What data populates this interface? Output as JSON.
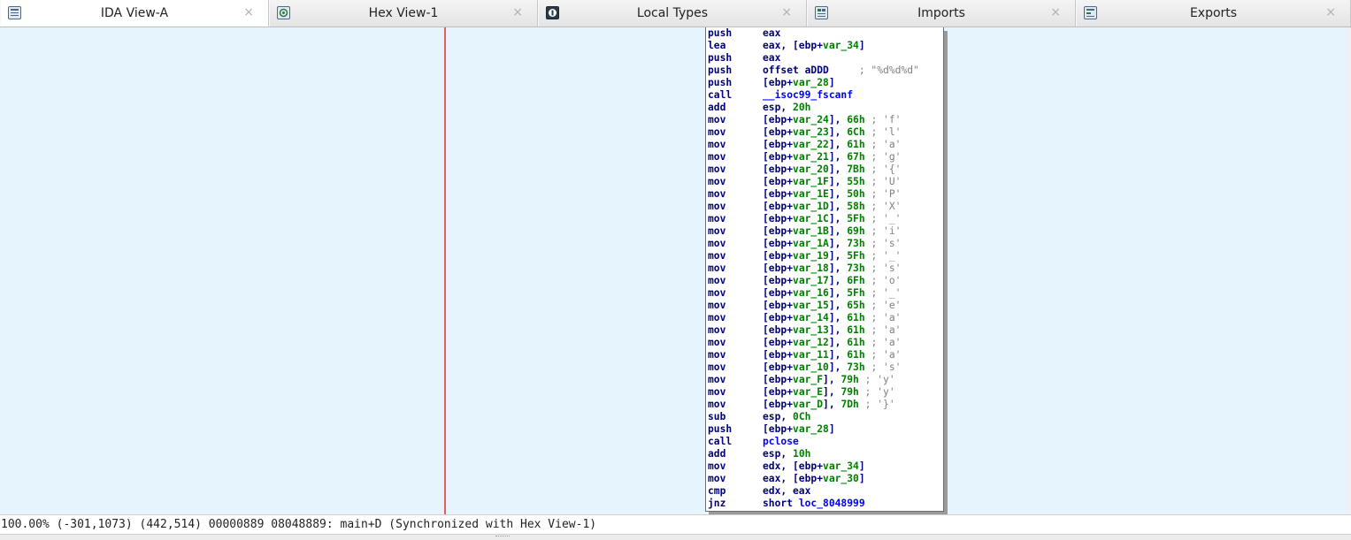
{
  "tabs": [
    {
      "label": "IDA View-A",
      "icon": "ida-view-icon",
      "close": "×",
      "active": true
    },
    {
      "label": "Hex View-1",
      "icon": "hex-view-icon",
      "close": "×",
      "active": false
    },
    {
      "label": "Local Types",
      "icon": "local-types-icon",
      "close": "×",
      "active": false
    },
    {
      "label": "Imports",
      "icon": "imports-icon",
      "close": "×",
      "active": false
    },
    {
      "label": "Exports",
      "icon": "exports-icon",
      "close": "×",
      "active": false
    }
  ],
  "colors": {
    "background": "#e6f5fd",
    "mnemonic": "#000080",
    "variable": "#008000",
    "symbol": "#0000ff",
    "comment": "#808080",
    "marker_line": "#e0605a"
  },
  "disasm": [
    {
      "m": "push",
      "parts": [
        [
          "op",
          "eax"
        ]
      ]
    },
    {
      "m": "lea",
      "parts": [
        [
          "op",
          "eax, [ebp+"
        ],
        [
          "var",
          "var_34"
        ],
        [
          "op",
          "]"
        ]
      ]
    },
    {
      "m": "push",
      "parts": [
        [
          "op",
          "eax"
        ]
      ]
    },
    {
      "m": "push",
      "parts": [
        [
          "op",
          "offset aDDD"
        ],
        [
          "cmt",
          "     ; \"%d%d%d\""
        ]
      ]
    },
    {
      "m": "push",
      "parts": [
        [
          "op",
          "[ebp+"
        ],
        [
          "var",
          "var_28"
        ],
        [
          "op",
          "]"
        ]
      ]
    },
    {
      "m": "call",
      "parts": [
        [
          "sym",
          "__isoc99_fscanf"
        ]
      ]
    },
    {
      "m": "add",
      "parts": [
        [
          "op",
          "esp, "
        ],
        [
          "num",
          "20h"
        ]
      ]
    },
    {
      "m": "mov",
      "parts": [
        [
          "op",
          "[ebp+"
        ],
        [
          "var",
          "var_24"
        ],
        [
          "op",
          "], "
        ],
        [
          "num",
          "66h"
        ],
        [
          "cmt",
          " ; 'f'"
        ]
      ]
    },
    {
      "m": "mov",
      "parts": [
        [
          "op",
          "[ebp+"
        ],
        [
          "var",
          "var_23"
        ],
        [
          "op",
          "], "
        ],
        [
          "num",
          "6Ch"
        ],
        [
          "cmt",
          " ; 'l'"
        ]
      ]
    },
    {
      "m": "mov",
      "parts": [
        [
          "op",
          "[ebp+"
        ],
        [
          "var",
          "var_22"
        ],
        [
          "op",
          "], "
        ],
        [
          "num",
          "61h"
        ],
        [
          "cmt",
          " ; 'a'"
        ]
      ]
    },
    {
      "m": "mov",
      "parts": [
        [
          "op",
          "[ebp+"
        ],
        [
          "var",
          "var_21"
        ],
        [
          "op",
          "], "
        ],
        [
          "num",
          "67h"
        ],
        [
          "cmt",
          " ; 'g'"
        ]
      ]
    },
    {
      "m": "mov",
      "parts": [
        [
          "op",
          "[ebp+"
        ],
        [
          "var",
          "var_20"
        ],
        [
          "op",
          "], "
        ],
        [
          "num",
          "7Bh"
        ],
        [
          "cmt",
          " ; '{'"
        ]
      ]
    },
    {
      "m": "mov",
      "parts": [
        [
          "op",
          "[ebp+"
        ],
        [
          "var",
          "var_1F"
        ],
        [
          "op",
          "], "
        ],
        [
          "num",
          "55h"
        ],
        [
          "cmt",
          " ; 'U'"
        ]
      ]
    },
    {
      "m": "mov",
      "parts": [
        [
          "op",
          "[ebp+"
        ],
        [
          "var",
          "var_1E"
        ],
        [
          "op",
          "], "
        ],
        [
          "num",
          "50h"
        ],
        [
          "cmt",
          " ; 'P'"
        ]
      ]
    },
    {
      "m": "mov",
      "parts": [
        [
          "op",
          "[ebp+"
        ],
        [
          "var",
          "var_1D"
        ],
        [
          "op",
          "], "
        ],
        [
          "num",
          "58h"
        ],
        [
          "cmt",
          " ; 'X'"
        ]
      ]
    },
    {
      "m": "mov",
      "parts": [
        [
          "op",
          "[ebp+"
        ],
        [
          "var",
          "var_1C"
        ],
        [
          "op",
          "], "
        ],
        [
          "num",
          "5Fh"
        ],
        [
          "cmt",
          " ; '_'"
        ]
      ]
    },
    {
      "m": "mov",
      "parts": [
        [
          "op",
          "[ebp+"
        ],
        [
          "var",
          "var_1B"
        ],
        [
          "op",
          "], "
        ],
        [
          "num",
          "69h"
        ],
        [
          "cmt",
          " ; 'i'"
        ]
      ]
    },
    {
      "m": "mov",
      "parts": [
        [
          "op",
          "[ebp+"
        ],
        [
          "var",
          "var_1A"
        ],
        [
          "op",
          "], "
        ],
        [
          "num",
          "73h"
        ],
        [
          "cmt",
          " ; 's'"
        ]
      ]
    },
    {
      "m": "mov",
      "parts": [
        [
          "op",
          "[ebp+"
        ],
        [
          "var",
          "var_19"
        ],
        [
          "op",
          "], "
        ],
        [
          "num",
          "5Fh"
        ],
        [
          "cmt",
          " ; '_'"
        ]
      ]
    },
    {
      "m": "mov",
      "parts": [
        [
          "op",
          "[ebp+"
        ],
        [
          "var",
          "var_18"
        ],
        [
          "op",
          "], "
        ],
        [
          "num",
          "73h"
        ],
        [
          "cmt",
          " ; 's'"
        ]
      ]
    },
    {
      "m": "mov",
      "parts": [
        [
          "op",
          "[ebp+"
        ],
        [
          "var",
          "var_17"
        ],
        [
          "op",
          "], "
        ],
        [
          "num",
          "6Fh"
        ],
        [
          "cmt",
          " ; 'o'"
        ]
      ]
    },
    {
      "m": "mov",
      "parts": [
        [
          "op",
          "[ebp+"
        ],
        [
          "var",
          "var_16"
        ],
        [
          "op",
          "], "
        ],
        [
          "num",
          "5Fh"
        ],
        [
          "cmt",
          " ; '_'"
        ]
      ]
    },
    {
      "m": "mov",
      "parts": [
        [
          "op",
          "[ebp+"
        ],
        [
          "var",
          "var_15"
        ],
        [
          "op",
          "], "
        ],
        [
          "num",
          "65h"
        ],
        [
          "cmt",
          " ; 'e'"
        ]
      ]
    },
    {
      "m": "mov",
      "parts": [
        [
          "op",
          "[ebp+"
        ],
        [
          "var",
          "var_14"
        ],
        [
          "op",
          "], "
        ],
        [
          "num",
          "61h"
        ],
        [
          "cmt",
          " ; 'a'"
        ]
      ]
    },
    {
      "m": "mov",
      "parts": [
        [
          "op",
          "[ebp+"
        ],
        [
          "var",
          "var_13"
        ],
        [
          "op",
          "], "
        ],
        [
          "num",
          "61h"
        ],
        [
          "cmt",
          " ; 'a'"
        ]
      ]
    },
    {
      "m": "mov",
      "parts": [
        [
          "op",
          "[ebp+"
        ],
        [
          "var",
          "var_12"
        ],
        [
          "op",
          "], "
        ],
        [
          "num",
          "61h"
        ],
        [
          "cmt",
          " ; 'a'"
        ]
      ]
    },
    {
      "m": "mov",
      "parts": [
        [
          "op",
          "[ebp+"
        ],
        [
          "var",
          "var_11"
        ],
        [
          "op",
          "], "
        ],
        [
          "num",
          "61h"
        ],
        [
          "cmt",
          " ; 'a'"
        ]
      ]
    },
    {
      "m": "mov",
      "parts": [
        [
          "op",
          "[ebp+"
        ],
        [
          "var",
          "var_10"
        ],
        [
          "op",
          "], "
        ],
        [
          "num",
          "73h"
        ],
        [
          "cmt",
          " ; 's'"
        ]
      ]
    },
    {
      "m": "mov",
      "parts": [
        [
          "op",
          "[ebp+"
        ],
        [
          "var",
          "var_F"
        ],
        [
          "op",
          "], "
        ],
        [
          "num",
          "79h"
        ],
        [
          "cmt",
          " ; 'y'"
        ]
      ]
    },
    {
      "m": "mov",
      "parts": [
        [
          "op",
          "[ebp+"
        ],
        [
          "var",
          "var_E"
        ],
        [
          "op",
          "], "
        ],
        [
          "num",
          "79h"
        ],
        [
          "cmt",
          " ; 'y'"
        ]
      ]
    },
    {
      "m": "mov",
      "parts": [
        [
          "op",
          "[ebp+"
        ],
        [
          "var",
          "var_D"
        ],
        [
          "op",
          "], "
        ],
        [
          "num",
          "7Dh"
        ],
        [
          "cmt",
          " ; '}'"
        ]
      ]
    },
    {
      "m": "sub",
      "parts": [
        [
          "op",
          "esp, "
        ],
        [
          "num",
          "0Ch"
        ]
      ]
    },
    {
      "m": "push",
      "parts": [
        [
          "op",
          "[ebp+"
        ],
        [
          "var",
          "var_28"
        ],
        [
          "op",
          "]"
        ]
      ]
    },
    {
      "m": "call",
      "parts": [
        [
          "sym",
          "pclose"
        ]
      ]
    },
    {
      "m": "add",
      "parts": [
        [
          "op",
          "esp, "
        ],
        [
          "num",
          "10h"
        ]
      ]
    },
    {
      "m": "mov",
      "parts": [
        [
          "op",
          "edx, [ebp+"
        ],
        [
          "var",
          "var_34"
        ],
        [
          "op",
          "]"
        ]
      ]
    },
    {
      "m": "mov",
      "parts": [
        [
          "op",
          "eax, [ebp+"
        ],
        [
          "var",
          "var_30"
        ],
        [
          "op",
          "]"
        ]
      ]
    },
    {
      "m": "cmp",
      "parts": [
        [
          "op",
          "edx, eax"
        ]
      ]
    },
    {
      "m": "jnz",
      "parts": [
        [
          "op",
          "short "
        ],
        [
          "sym",
          "loc_8048999"
        ]
      ]
    }
  ],
  "status": {
    "text": "100.00% (-301,1073) (442,514) 00000889 08048889: main+D (Synchronized with Hex View-1)"
  }
}
